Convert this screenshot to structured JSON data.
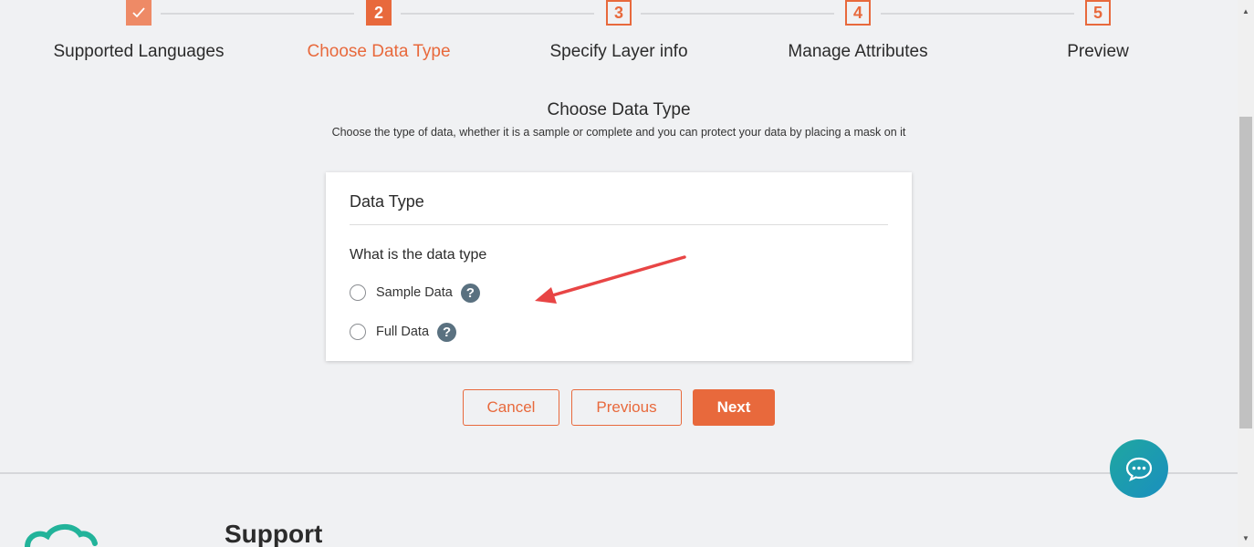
{
  "stepper": {
    "steps": [
      {
        "number": "",
        "label": "Supported Languages",
        "state": "done"
      },
      {
        "number": "2",
        "label": "Choose Data Type",
        "state": "active"
      },
      {
        "number": "3",
        "label": "Specify Layer info",
        "state": "pending"
      },
      {
        "number": "4",
        "label": "Manage Attributes",
        "state": "pending"
      },
      {
        "number": "5",
        "label": "Preview",
        "state": "pending"
      }
    ]
  },
  "section": {
    "title": "Choose Data Type",
    "description": "Choose the type of data, whether it is a sample or complete and you can protect your data by placing a mask on it"
  },
  "card": {
    "title": "Data Type",
    "question": "What is the data type",
    "options": [
      {
        "label": "Sample Data",
        "help": "?"
      },
      {
        "label": "Full Data",
        "help": "?"
      }
    ]
  },
  "actions": {
    "cancel": "Cancel",
    "previous": "Previous",
    "next": "Next"
  },
  "footer": {
    "support_heading": "Support"
  },
  "colors": {
    "accent": "#e8693c",
    "help_icon": "#5a7180",
    "chat_bubble": "#1fa7a0"
  },
  "icons": {
    "step_done": "check-icon",
    "help": "question-circle-icon",
    "chat": "chat-bubble-icon"
  }
}
